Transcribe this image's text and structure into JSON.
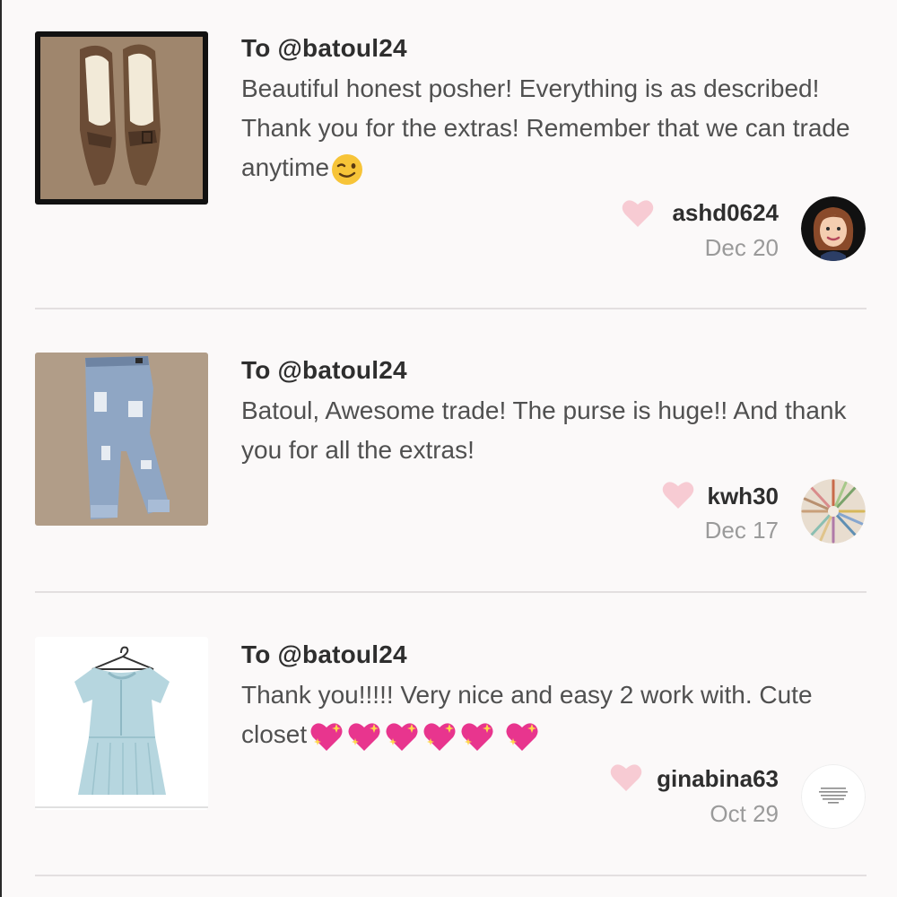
{
  "feedback": [
    {
      "to": "To @batoul24",
      "message": "Beautiful honest posher! Everything is as described! Thank you for the extras! Remember that we can trade anytime",
      "message_emoji": "winking-face",
      "item_image": "brown pointed heels",
      "username": "ashd0624",
      "date": "Dec 20",
      "avatar": "bitmoji-woman-avatar"
    },
    {
      "to": "To @batoul24",
      "message": "Batoul, Awesome trade! The purse is huge!! And thank you for all the extras!",
      "message_emoji": "",
      "item_image": "distressed light wash jeans",
      "username": "kwh30",
      "date": "Dec 17",
      "avatar": "colored-pencils-avatar"
    },
    {
      "to": "To @batoul24",
      "message": "Thank you!!!!! Very nice and easy 2 work with. Cute closet",
      "message_emoji": "sparkling-heart x6",
      "item_image": "light blue flutter sleeve top",
      "username": "ginabina63",
      "date": "Oct 29",
      "avatar": "quote-text-avatar"
    }
  ],
  "icons": {
    "heart": "heart-icon",
    "heart_color": "#f7cbd3"
  },
  "colors": {
    "background": "#fbf9f9",
    "username": "#2e2e2e",
    "date": "#9a9a9a",
    "divider": "#e3dfe0"
  }
}
